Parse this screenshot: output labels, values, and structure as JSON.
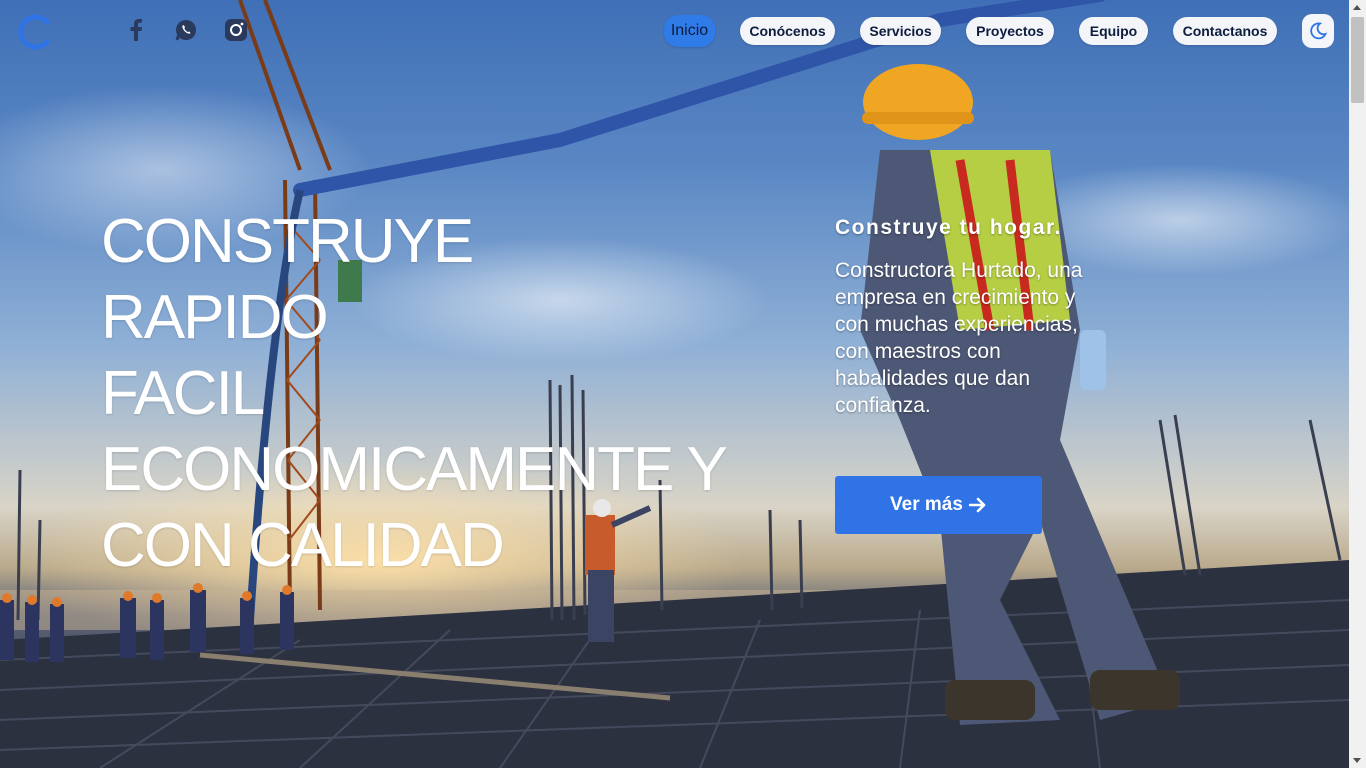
{
  "brand": {
    "logo_icon": "c-logo-icon",
    "accent_color": "#2f73e6"
  },
  "social": [
    {
      "name": "facebook-icon"
    },
    {
      "name": "whatsapp-icon"
    },
    {
      "name": "instagram-icon"
    }
  ],
  "nav": {
    "items": [
      {
        "label": "Inicio",
        "active": true
      },
      {
        "label": "Conócenos"
      },
      {
        "label": "Servicios"
      },
      {
        "label": "Proyectos"
      },
      {
        "label": "Equipo"
      },
      {
        "label": "Contactanos"
      }
    ],
    "theme_icon": "moon-icon"
  },
  "hero": {
    "headline_lines": [
      "CONSTRUYE",
      "RAPIDO",
      "FACIL",
      "ECONOMICAMENTE Y",
      "CON CALIDAD"
    ],
    "tagline": "Construye tu hogar.",
    "description": "Constructora Hurtado, una empresa en crecimiento y con muchas experiencias, con maestros con habalidades que dan confianza.",
    "cta_label": "Ver más",
    "cta_icon": "arrow-right-icon"
  }
}
